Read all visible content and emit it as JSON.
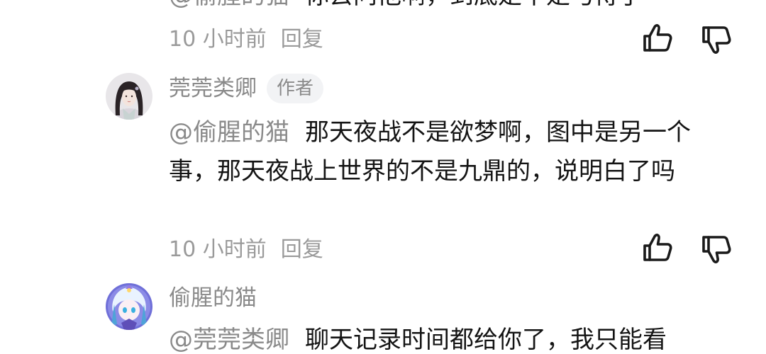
{
  "comments": [
    {
      "mention": "@偷腥的猫",
      "text": "你去问他啊，到底是不是弓侍了",
      "time": "10 小时前",
      "reply_label": "回复"
    },
    {
      "username": "莞莞类卿",
      "badge": "作者",
      "mention": "@偷腥的猫",
      "text": "那天夜战不是欲梦啊，图中是另一个事，那天夜战上世界的不是九鼎的，说明白了吗",
      "time": "10 小时前",
      "reply_label": "回复"
    },
    {
      "username": "偷腥的猫",
      "mention": "@莞莞类卿",
      "text": "聊天记录时间都给你了，我只能看"
    }
  ],
  "icons": {
    "like": "thumbs-up-icon",
    "dislike": "thumbs-down-icon"
  },
  "colors": {
    "text_primary": "#141414",
    "text_secondary": "#8a8a8a",
    "meta": "#9a9a9a",
    "badge_bg": "#f2f3f5"
  }
}
